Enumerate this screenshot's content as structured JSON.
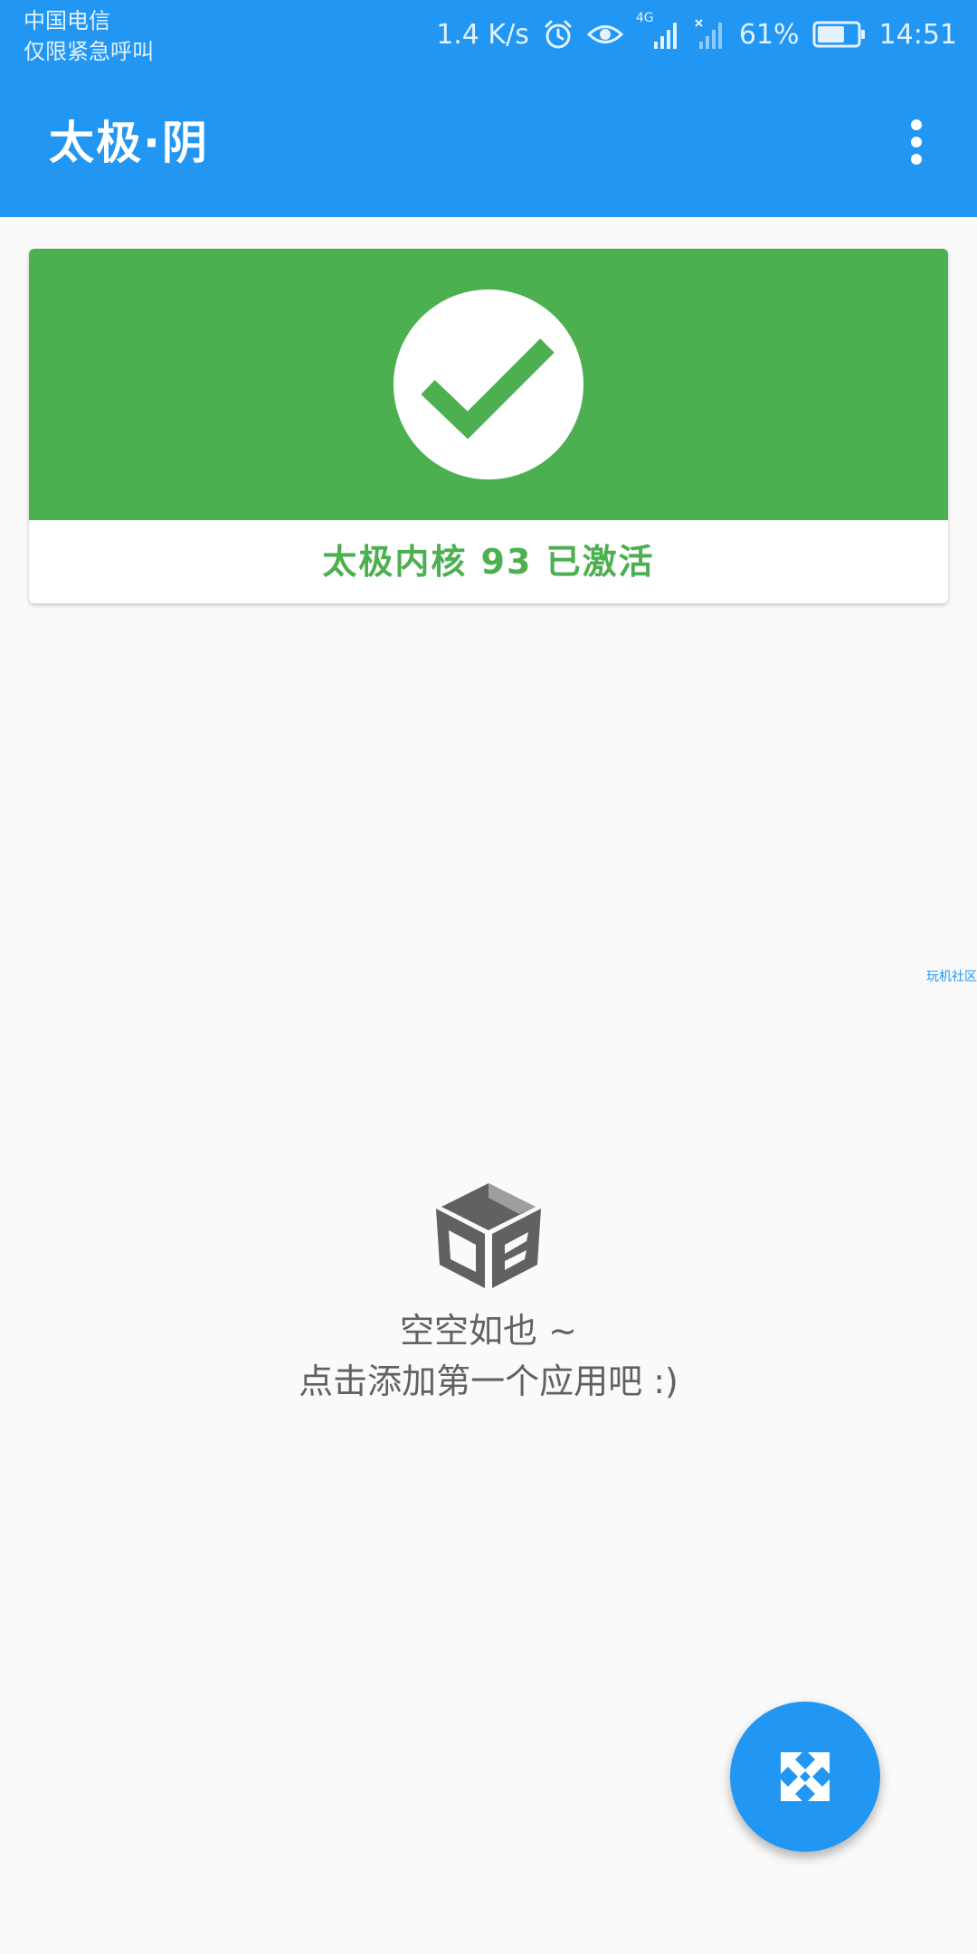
{
  "status_bar": {
    "carrier": "中国电信",
    "emergency": "仅限紧急呼叫",
    "speed": "1.4 K/s",
    "network": "4G",
    "battery": "61%",
    "time": "14:51",
    "icons": [
      "alarm-icon",
      "eye-icon",
      "signal-icon",
      "signal-no-sim-icon",
      "battery-icon"
    ]
  },
  "appbar": {
    "title": "太极·阴",
    "menu_icon": "more-vert-icon",
    "color": "#2196f3"
  },
  "status_card": {
    "icon": "check-icon",
    "text": "太极内核 93 已激活",
    "color": "#4caf50"
  },
  "side_tag": "玩机社区",
  "empty_state": {
    "icon": "package-box-icon",
    "line1": "空空如也 ~",
    "line2": "点击添加第一个应用吧 :)"
  },
  "fab": {
    "icon": "expand-arrows-icon",
    "color": "#2196f3"
  }
}
